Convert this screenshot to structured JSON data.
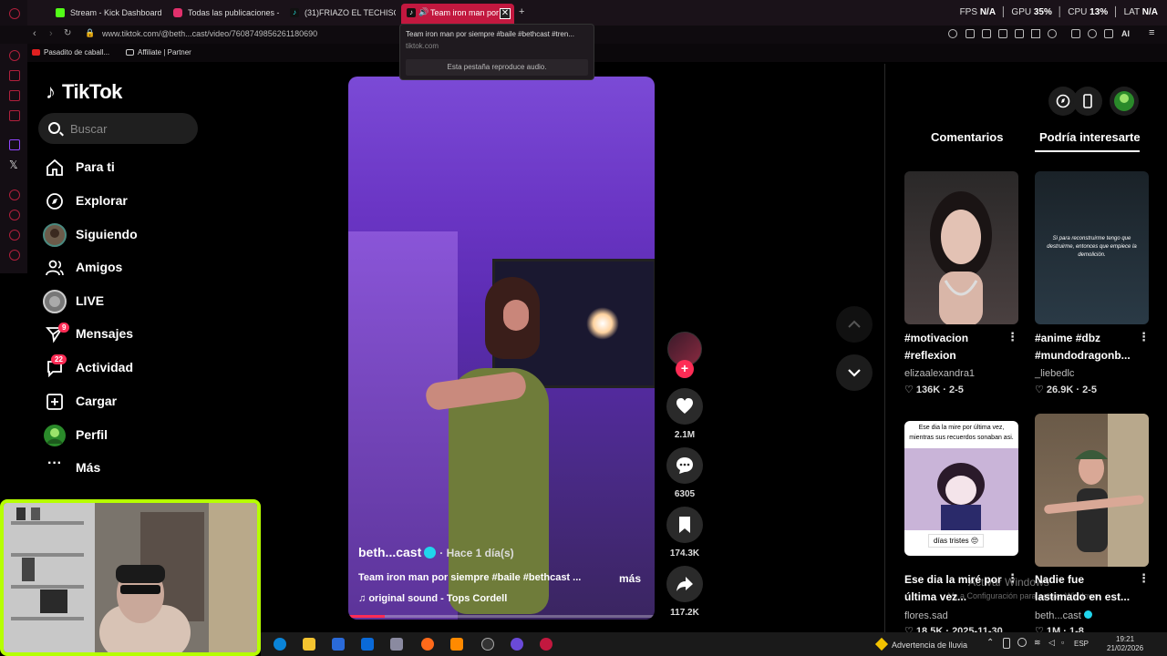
{
  "browser": {
    "tabs": [
      {
        "label": "Stream - Kick Dashboard",
        "color": "#53fc18"
      },
      {
        "label": "Todas las publicaciones -",
        "color": "#e1306c"
      },
      {
        "label": "(31)FRIAZO EL TECHISOR",
        "color": "#25f4ee"
      },
      {
        "label": "Team iron man por",
        "color": "#fe2c55",
        "active": true
      }
    ],
    "new_tab": "+",
    "perf": {
      "fps_label": "FPS",
      "fps": "N/A",
      "gpu_label": "GPU",
      "gpu": "35%",
      "cpu_label": "CPU",
      "cpu": "13%",
      "lat_label": "LAT",
      "lat": "N/A"
    },
    "url": "www.tiktok.com/@beth...cast/video/7608749856261180690",
    "ai_label": "AI",
    "bookmarks": [
      "Pasadito de caball...",
      "Affiliate | Partner"
    ]
  },
  "tooltip": {
    "title": "Team iron man por siempre #baile #bethcast #tren...",
    "domain": "tiktok.com",
    "audio": "Esta pestaña reproduce audio."
  },
  "sidebar": {
    "logo": "TikTok",
    "search_placeholder": "Buscar",
    "items": [
      {
        "label": "Para ti",
        "icon": "home-icon"
      },
      {
        "label": "Explorar",
        "icon": "compass-icon"
      },
      {
        "label": "Siguiendo",
        "icon": "following-avatar-icon"
      },
      {
        "label": "Amigos",
        "icon": "friends-icon"
      },
      {
        "label": "LIVE",
        "icon": "live-icon"
      },
      {
        "label": "Mensajes",
        "icon": "messages-icon",
        "badge": "9"
      },
      {
        "label": "Actividad",
        "icon": "activity-icon",
        "badge": "22"
      },
      {
        "label": "Cargar",
        "icon": "upload-icon"
      },
      {
        "label": "Perfil",
        "icon": "profile-icon"
      },
      {
        "label": "Más",
        "icon": "more-icon"
      }
    ]
  },
  "video": {
    "username": "beth...cast",
    "time": "· Hace 1 día(s)",
    "description": "Team iron man por siempre #baile #bethcast ...",
    "more": "más",
    "sound": "original sound - Tops Cordell",
    "progress": 0.12
  },
  "actions": {
    "likes": "2.1M",
    "comments": "6305",
    "saves": "174.3K",
    "shares": "117.2K"
  },
  "right_panel": {
    "tabs": [
      "Comentarios",
      "Podría interesarte"
    ],
    "cards": [
      {
        "title": "#motivacion #reflexion",
        "user": "elizaalexandra1",
        "likes": "136K",
        "age": "2-5"
      },
      {
        "title": "#anime #dbz #mundodragonb...",
        "user": "_liebedlc",
        "likes": "26.9K",
        "age": "2-5",
        "overlay": "Si para reconstruirme tengo que destruirme, entonces que empiece la demolición."
      },
      {
        "title": "Ese dia la miré por última vez...",
        "user": "flores.sad",
        "likes": "18.5K",
        "age": "2025-11-30",
        "overlay": "Ese dia la mire por última vez, mientras sus recuerdos sonaban asi.",
        "caption": "días tristes 😔"
      },
      {
        "title": "Nadie fue lastimado en est...",
        "user": "beth...cast",
        "likes": "1M",
        "age": "1-8"
      }
    ]
  },
  "watermark": {
    "line1": "Activar Windows",
    "line2": "Ve a Configuración para activar Windows."
  },
  "taskbar": {
    "weather": "Advertencia de lluvia",
    "lang": "ESP",
    "time": "19:21",
    "date": "21/02/2026"
  },
  "colors": {
    "accent": "#fe2c55",
    "cam_border": "#b6ff00",
    "verified": "#20d5ec"
  }
}
